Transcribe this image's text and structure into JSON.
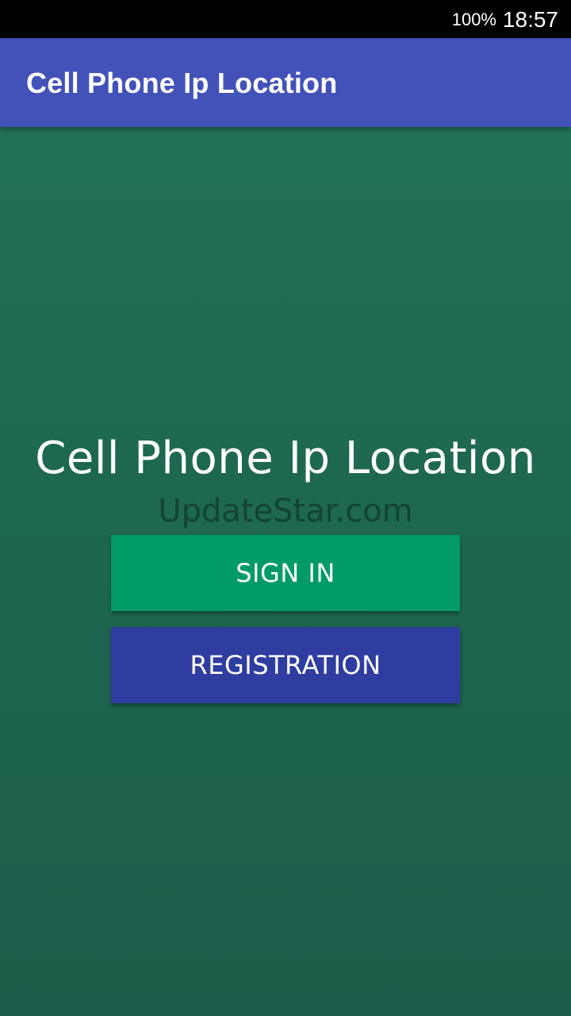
{
  "status_bar": {
    "battery": "100%",
    "time": "18:57"
  },
  "app_bar": {
    "title": "Cell Phone Ip Location"
  },
  "main": {
    "title": "Cell Phone Ip Location",
    "watermark": "UpdateStar.com",
    "sign_in_label": "SIGN IN",
    "registration_label": "REGISTRATION"
  },
  "colors": {
    "app_bar": "#4252b8",
    "background": "#1e6a52",
    "sign_in_button": "#009a66",
    "registration_button": "#2f3da0"
  }
}
